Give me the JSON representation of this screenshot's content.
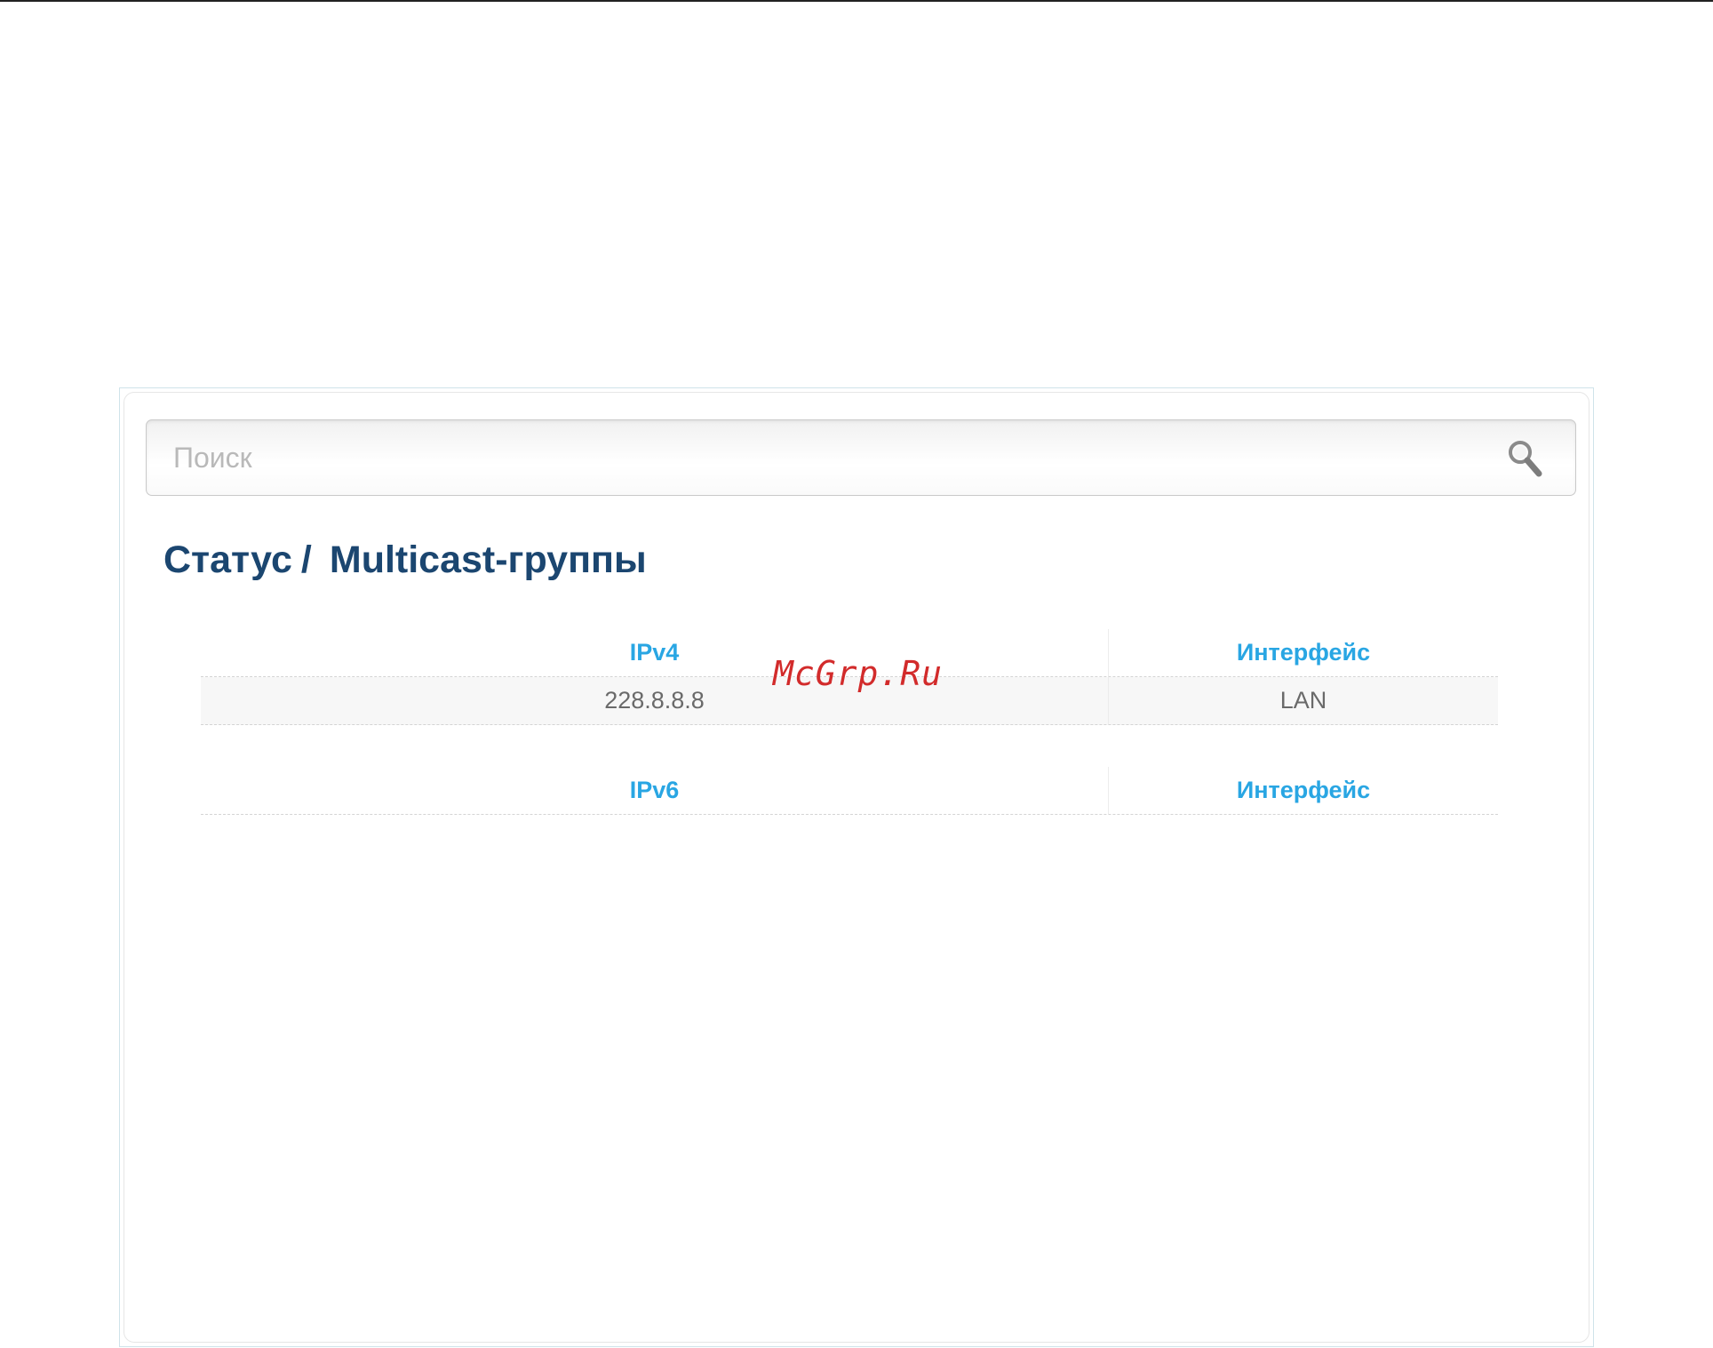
{
  "search": {
    "placeholder": "Поиск",
    "icon": "search-icon"
  },
  "breadcrumb": {
    "parent": "Статус",
    "separator": "/",
    "current": "Multicast-группы"
  },
  "ipv4_table": {
    "columns": [
      "IPv4",
      "Интерфейс"
    ],
    "rows": [
      [
        "228.8.8.8",
        "LAN"
      ]
    ]
  },
  "ipv6_table": {
    "columns": [
      "IPv6",
      "Интерфейс"
    ],
    "rows": []
  },
  "watermark": "McGrp.Ru",
  "colors": {
    "title": "#1b4670",
    "table_header": "#29a6e3",
    "watermark": "#d22b2b"
  }
}
